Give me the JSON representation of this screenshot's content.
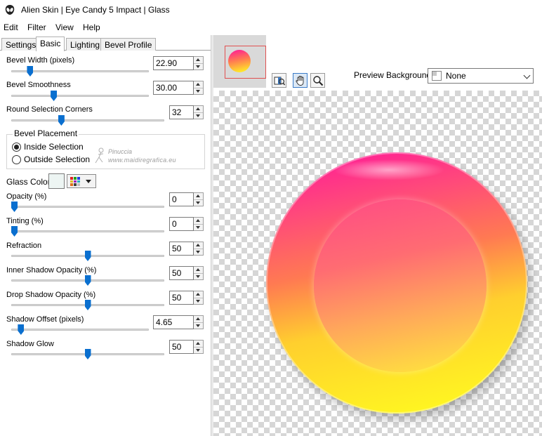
{
  "window": {
    "title": "Alien Skin | Eye Candy 5 Impact | Glass"
  },
  "menu": [
    "Edit",
    "Filter",
    "View",
    "Help"
  ],
  "tabs": [
    {
      "label": "Settings",
      "active": false
    },
    {
      "label": "Basic",
      "active": true
    },
    {
      "label": "Lighting",
      "active": false
    },
    {
      "label": "Bevel Profile",
      "active": false
    }
  ],
  "params": {
    "bevel_width": {
      "label": "Bevel Width (pixels)",
      "value": "22.90",
      "fraction": 0.12
    },
    "bevel_smoothness": {
      "label": "Bevel Smoothness",
      "value": "30.00",
      "fraction": 0.3
    },
    "round_corners": {
      "label": "Round Selection Corners",
      "value": "32",
      "fraction": 0.32
    },
    "opacity": {
      "label": "Opacity (%)",
      "value": "0",
      "fraction": 0.0
    },
    "tinting": {
      "label": "Tinting (%)",
      "value": "0",
      "fraction": 0.0
    },
    "refraction": {
      "label": "Refraction",
      "value": "50",
      "fraction": 0.5
    },
    "inner_shadow": {
      "label": "Inner Shadow Opacity (%)",
      "value": "50",
      "fraction": 0.5
    },
    "drop_shadow": {
      "label": "Drop Shadow Opacity (%)",
      "value": "50",
      "fraction": 0.5
    },
    "shadow_offset": {
      "label": "Shadow Offset (pixels)",
      "value": "4.65",
      "fraction": 0.05
    },
    "shadow_glow": {
      "label": "Shadow Glow",
      "value": "50",
      "fraction": 0.5
    }
  },
  "bevel_placement": {
    "title": "Bevel Placement",
    "options": [
      {
        "label": "Inside Selection",
        "checked": true
      },
      {
        "label": "Outside Selection",
        "checked": false
      }
    ]
  },
  "glass_color": {
    "label": "Glass Color",
    "value": "#edf5f3"
  },
  "watermark": {
    "line1": "Pinuccia",
    "line2": "www.maidiregrafica.eu"
  },
  "preview": {
    "background_label": "Preview Background:",
    "background_value": "None"
  },
  "toolbar_icons": [
    "before-after-icon",
    "hand-pan-icon",
    "zoom-icon"
  ],
  "colors": {
    "accent": "#0a6fcf",
    "gradient_magenta": "#ff149c",
    "gradient_yellow": "#ffff1e",
    "nav_frame": "#e05050"
  }
}
